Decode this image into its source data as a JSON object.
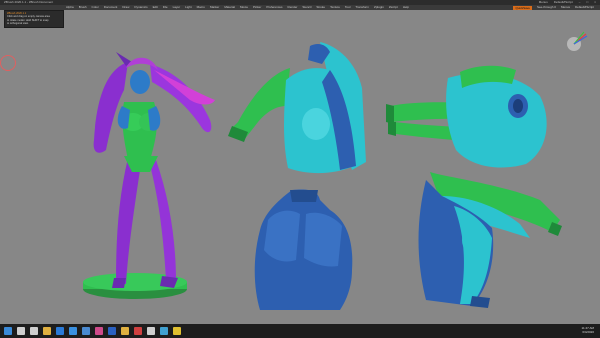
{
  "app": {
    "title": "ZBrush 2020.1.1 - ZBrush Document",
    "title_right": [
      "Menus",
      "DefaultZScript"
    ]
  },
  "menubar": {
    "items": [
      "Alpha",
      "Brush",
      "Color",
      "Document",
      "Draw",
      "Dynamics",
      "Edit",
      "File",
      "Layer",
      "Light",
      "Macro",
      "Marker",
      "Material",
      "Movie",
      "Picker",
      "Preferences",
      "Render",
      "Stencil",
      "Stroke",
      "Texture",
      "Tool",
      "Transform",
      "Zplugin",
      "Zscript",
      "Help"
    ],
    "quicksave": "QuickSave",
    "see_through": "See-through 0",
    "right_labels": [
      "Menus",
      "DefaultZScript"
    ]
  },
  "tooltip": {
    "title": "ZBrush 2020.1.1",
    "lines": [
      "Click and drag on empty canvas area",
      "to rotate model. Hold SHIFT to snap",
      "to orthogonal view."
    ]
  },
  "taskbar": {
    "time": "11:47 AM",
    "date": "6/4/2020"
  },
  "icons": [
    "start-icon",
    "search-icon",
    "task-view-icon",
    "file-explorer-icon",
    "browser-icon",
    "mail-icon",
    "store-icon",
    "zbrush-icon",
    "photoshop-icon",
    "folder-icon",
    "media-icon",
    "settings-icon",
    "app-icon",
    "notes-icon"
  ],
  "colors": {
    "canvas": "#878787",
    "green": "#2fbf4f",
    "cyan": "#2cc3cf",
    "blue": "#2d5fb0",
    "purple": "#8a2fcf",
    "magenta": "#d240d8",
    "accent": "#d96c1a"
  }
}
